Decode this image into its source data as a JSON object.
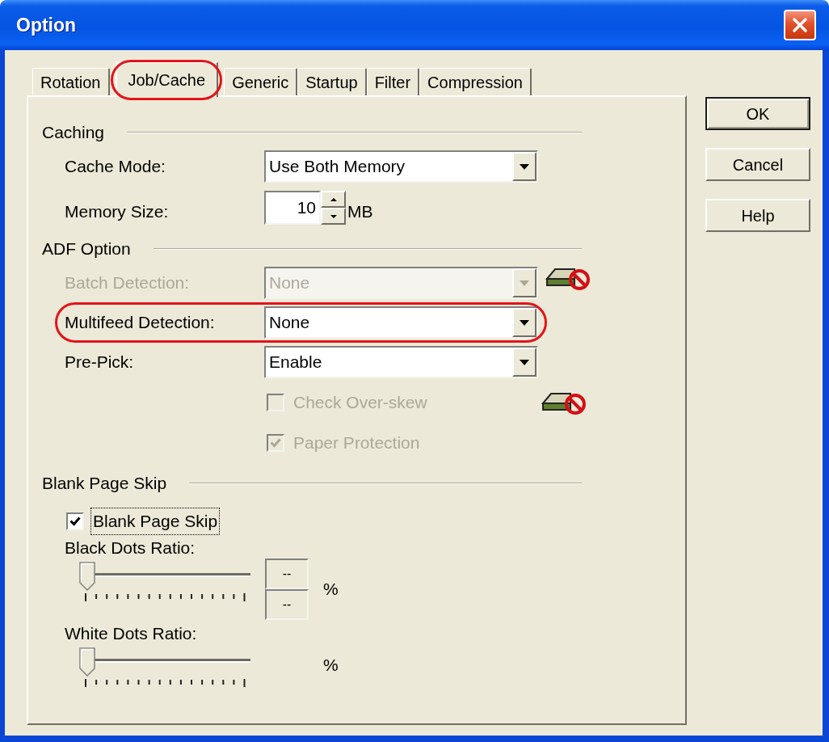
{
  "window": {
    "title": "Option"
  },
  "tabs": [
    {
      "label": "Rotation",
      "selected": false,
      "highlighted": false
    },
    {
      "label": "Job/Cache",
      "selected": true,
      "highlighted": true
    },
    {
      "label": "Generic",
      "selected": false,
      "highlighted": false
    },
    {
      "label": "Startup",
      "selected": false,
      "highlighted": false
    },
    {
      "label": "Filter",
      "selected": false,
      "highlighted": false
    },
    {
      "label": "Compression",
      "selected": false,
      "highlighted": false
    }
  ],
  "groups": [
    {
      "title": "Caching",
      "items": [
        {
          "kind": "combo",
          "label": "Cache Mode:",
          "value": "Use Both Memory",
          "disabled": false,
          "highlighted": false,
          "prohibited_icon": false
        },
        {
          "kind": "spin",
          "label": "Memory Size:",
          "value": "10",
          "unit": "MB",
          "disabled": false,
          "highlighted": false
        }
      ]
    },
    {
      "title": "ADF Option",
      "items": [
        {
          "kind": "combo",
          "label": "Batch Detection:",
          "value": "None",
          "disabled": true,
          "highlighted": false,
          "prohibited_icon": true
        },
        {
          "kind": "combo",
          "label": "Multifeed Detection:",
          "value": "None",
          "disabled": false,
          "highlighted": true,
          "prohibited_icon": false
        },
        {
          "kind": "combo",
          "label": "Pre-Pick:",
          "value": "Enable",
          "disabled": false,
          "highlighted": false,
          "prohibited_icon": false
        },
        {
          "kind": "field_checkbox",
          "label": "Check Over-skew",
          "checked": false,
          "disabled": true,
          "focused": false,
          "highlighted": false,
          "prohibited_icon": true
        },
        {
          "kind": "field_checkbox",
          "label": "Paper Protection",
          "checked": true,
          "disabled": true,
          "focused": false,
          "highlighted": false,
          "prohibited_icon": false
        }
      ]
    },
    {
      "title": "Blank Page Skip",
      "items": [
        {
          "kind": "checkbox",
          "label": "Blank Page Skip",
          "checked": true,
          "disabled": false,
          "focused": true,
          "highlighted": false
        },
        {
          "kind": "slider",
          "label": "Black Dots Ratio:",
          "level": 0,
          "readouts": [
            "--",
            "--"
          ],
          "unit": "%",
          "disabled": false,
          "highlighted": false
        },
        {
          "kind": "slider",
          "label": "White Dots Ratio:",
          "level": 0,
          "unit": "%",
          "disabled": false,
          "highlighted": false
        }
      ]
    }
  ],
  "buttons": [
    {
      "label": "OK",
      "default": true
    },
    {
      "label": "Cancel",
      "default": false
    },
    {
      "label": "Help",
      "default": false
    }
  ]
}
